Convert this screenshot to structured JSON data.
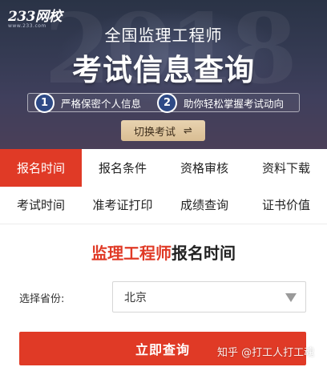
{
  "banner": {
    "logo": "233网校",
    "logo_url": "www.233.com",
    "title": "全国监理工程师",
    "headline": "考试信息查询",
    "features": [
      {
        "num": "1",
        "text": "严格保密个人信息"
      },
      {
        "num": "2",
        "text": "助你轻松掌握考试动向"
      }
    ],
    "switch_label": "切换考试",
    "switch_icon": "⇌"
  },
  "nav": {
    "row1": [
      "报名时间",
      "报名条件",
      "资格审核",
      "资料下载"
    ],
    "row2": [
      "考试时间",
      "准考证打印",
      "成绩查询",
      "证书价值"
    ],
    "active": "报名时间"
  },
  "query": {
    "title_highlight": "监理工程师",
    "title_rest": "报名时间",
    "province_label": "选择省份:",
    "province_value": "北京",
    "button_label": "立即查询"
  },
  "watermark": "知乎 @打工人打工魂",
  "colors": {
    "accent": "#e03a26",
    "banner_bg": "#343a52",
    "switch_bg": "#e0c8a2"
  }
}
